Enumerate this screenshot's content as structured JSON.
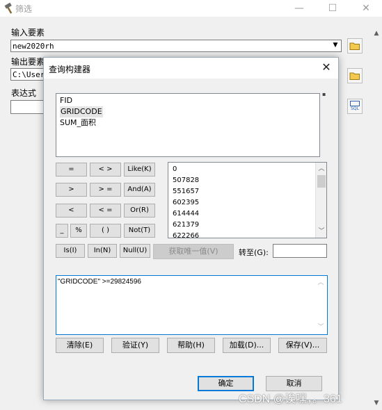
{
  "background_window": {
    "title": "筛选",
    "input_features_label": "输入要素",
    "input_features_value": "new2020rh",
    "output_features_label": "输出要素",
    "output_features_value": "C:\\User",
    "expression_label": "表达式",
    "sql_icon_text": "SQL"
  },
  "dialog": {
    "title": "查询构建器",
    "fields": [
      "FID",
      "GRIDCODE",
      "SUM_面积"
    ],
    "selected_field": "GRIDCODE",
    "operators": {
      "eq": "=",
      "ne": "< >",
      "like": "Like(K)",
      "gt": ">",
      "ge": "> =",
      "and": "And(A)",
      "lt": "<",
      "le": "< =",
      "or": "Or(R)",
      "underscore": "_",
      "percent": "%",
      "paren": "( )",
      "not": "Not(T)",
      "is": "Is(I)",
      "in": "In(N)",
      "null": "Null(U)"
    },
    "unique_values": [
      "0",
      "507828",
      "551657",
      "602395",
      "614444",
      "621379",
      "622266"
    ],
    "get_unique_values_button": "获取唯一值(V)",
    "goto_label": "转至(G):",
    "goto_value": "",
    "expression": "\"GRIDCODE\" >=29824596",
    "buttons": {
      "clear": "清除(E)",
      "verify": "验证(Y)",
      "help": "帮助(H)",
      "load": "加载(D)...",
      "save": "保存(V)..."
    },
    "ok": "确定",
    "cancel": "取消"
  },
  "watermark": "CSDN @诶嘿，。361"
}
